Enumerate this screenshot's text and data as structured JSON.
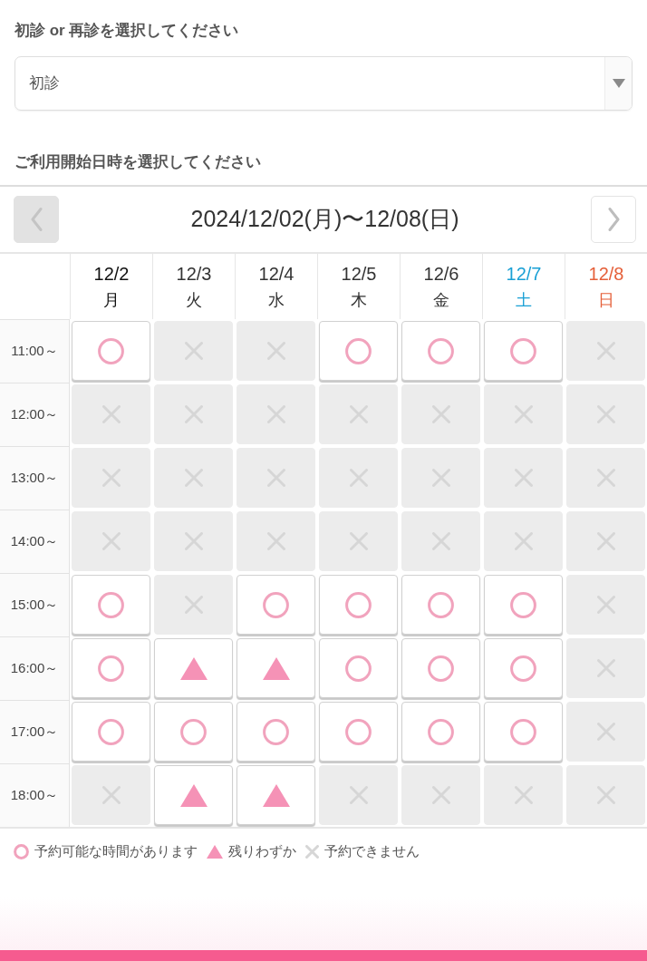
{
  "visit_type": {
    "label": "初診 or 再診を選択してください",
    "value": "初診"
  },
  "schedule": {
    "label": "ご利用開始日時を選択してください",
    "prev_button": {
      "disabled": true
    },
    "next_button": {
      "disabled": false
    },
    "range": "2024/12/02(月)〜12/08(日)",
    "days": [
      {
        "date": "12/2",
        "weekday": "月",
        "color": "#111111"
      },
      {
        "date": "12/3",
        "weekday": "火",
        "color": "#333333"
      },
      {
        "date": "12/4",
        "weekday": "水",
        "color": "#333333"
      },
      {
        "date": "12/5",
        "weekday": "木",
        "color": "#333333"
      },
      {
        "date": "12/6",
        "weekday": "金",
        "color": "#333333"
      },
      {
        "date": "12/7",
        "weekday": "土",
        "color": "#1aa0d5"
      },
      {
        "date": "12/8",
        "weekday": "日",
        "color": "#e5603a"
      }
    ],
    "rows": [
      {
        "time": "11:00～",
        "slots": [
          {
            "kind": "open"
          },
          {
            "kind": "full"
          },
          {
            "kind": "full"
          },
          {
            "kind": "open"
          },
          {
            "kind": "open"
          },
          {
            "kind": "open"
          },
          {
            "kind": "full"
          }
        ]
      },
      {
        "time": "12:00～",
        "slots": [
          {
            "kind": "full"
          },
          {
            "kind": "full"
          },
          {
            "kind": "full"
          },
          {
            "kind": "full"
          },
          {
            "kind": "full"
          },
          {
            "kind": "full"
          },
          {
            "kind": "full"
          }
        ]
      },
      {
        "time": "13:00～",
        "slots": [
          {
            "kind": "full"
          },
          {
            "kind": "full"
          },
          {
            "kind": "full"
          },
          {
            "kind": "full"
          },
          {
            "kind": "full"
          },
          {
            "kind": "full"
          },
          {
            "kind": "full"
          }
        ]
      },
      {
        "time": "14:00～",
        "slots": [
          {
            "kind": "full"
          },
          {
            "kind": "full"
          },
          {
            "kind": "full"
          },
          {
            "kind": "full"
          },
          {
            "kind": "full"
          },
          {
            "kind": "full"
          },
          {
            "kind": "full"
          }
        ]
      },
      {
        "time": "15:00～",
        "slots": [
          {
            "kind": "open"
          },
          {
            "kind": "full"
          },
          {
            "kind": "open"
          },
          {
            "kind": "open"
          },
          {
            "kind": "open"
          },
          {
            "kind": "open"
          },
          {
            "kind": "full"
          }
        ]
      },
      {
        "time": "16:00～",
        "slots": [
          {
            "kind": "open"
          },
          {
            "kind": "few"
          },
          {
            "kind": "few"
          },
          {
            "kind": "open"
          },
          {
            "kind": "open"
          },
          {
            "kind": "open"
          },
          {
            "kind": "full"
          }
        ]
      },
      {
        "time": "17:00～",
        "slots": [
          {
            "kind": "open"
          },
          {
            "kind": "open"
          },
          {
            "kind": "open"
          },
          {
            "kind": "open"
          },
          {
            "kind": "open"
          },
          {
            "kind": "open"
          },
          {
            "kind": "full"
          }
        ]
      },
      {
        "time": "18:00～",
        "slots": [
          {
            "kind": "full"
          },
          {
            "kind": "few"
          },
          {
            "kind": "few"
          },
          {
            "kind": "full"
          },
          {
            "kind": "full"
          },
          {
            "kind": "full"
          },
          {
            "kind": "full"
          }
        ]
      }
    ],
    "legend": [
      {
        "kind": "open",
        "text": "予約可能な時間があります"
      },
      {
        "kind": "few",
        "text": "残りわずか"
      },
      {
        "kind": "full",
        "text": "予約できません"
      }
    ]
  }
}
